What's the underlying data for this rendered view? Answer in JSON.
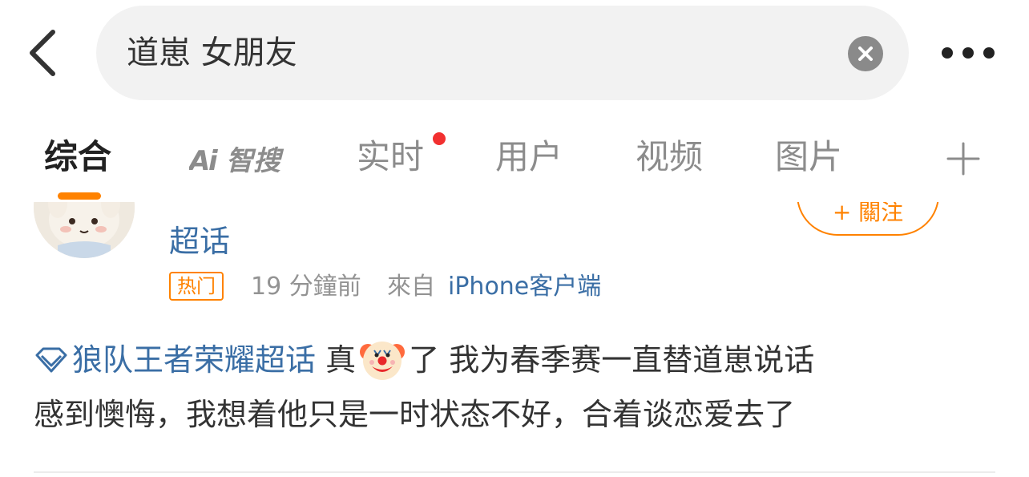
{
  "search": {
    "query": "道崽 女朋友",
    "back_icon": "chevron-left-icon",
    "clear_icon": "close-circle-icon",
    "more_icon": "ellipsis-icon"
  },
  "tabs": [
    {
      "label": "综合",
      "active": true
    },
    {
      "label": "Ai智搜",
      "active": false
    },
    {
      "label": "实时",
      "active": false,
      "has_dot": true
    },
    {
      "label": "用户",
      "active": false
    },
    {
      "label": "视频",
      "active": false
    },
    {
      "label": "图片",
      "active": false
    }
  ],
  "colors": {
    "accent": "#ff8200",
    "link": "#3a6ea5",
    "notification_dot": "#f23030",
    "muted_text": "#939393"
  },
  "post": {
    "username": "超话",
    "follow_label": "+ 關注",
    "hot_badge": "热门",
    "time": "19 分鐘前",
    "from_label": "來自",
    "source": "iPhone客户端",
    "topic": "狼队王者荣耀超话",
    "text_before_emoji": "真",
    "emoji": "clown-face",
    "text_after_emoji": "了 我为春季赛一直替道崽说话",
    "text_line2": "感到懊悔，我想着他只是一时状态不好，合着谈恋爱去了"
  }
}
